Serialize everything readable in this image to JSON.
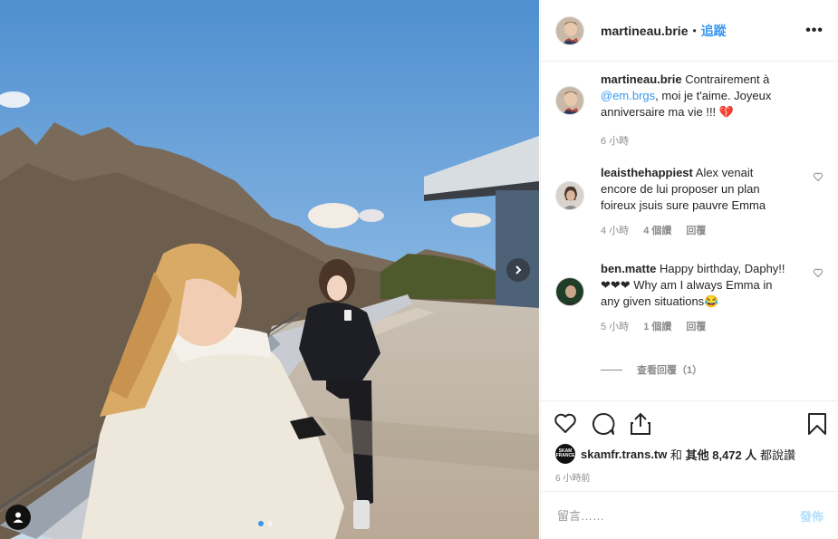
{
  "post": {
    "username": "martineau.brie",
    "separator": "•",
    "follow_label": "追蹤",
    "more_icon": "more-options-icon"
  },
  "photo": {
    "carousel_count": 2,
    "active_index": 0
  },
  "caption": {
    "username": "martineau.brie",
    "text_before": " Contrairement à ",
    "mention": "@em.brgs",
    "text_after": ", moi je t'aime. Joyeux anniversaire ma vie !!! 💔",
    "time": "6 小時"
  },
  "comments": [
    {
      "username": "leaisthehappiest",
      "text": " Alex venait encore de lui proposer un plan foireux jsuis sure pauvre Emma",
      "time": "4 小時",
      "likes": "4 個讚",
      "reply": "回覆"
    },
    {
      "username": "ben.matte",
      "text": " Happy birthday, Daphy!!❤❤❤ Why am I always Emma in any given situations😂",
      "time": "5 小時",
      "likes": "1 個讚",
      "reply": "回覆"
    }
  ],
  "view_replies": "查看回覆（1）",
  "likes": {
    "first_user": "skamfr.trans.tw",
    "text_mid": " 和 ",
    "others": "其他 8,472 人",
    "text_end": " 都說讚",
    "mini_avatar_text": "SKAM FRANCE"
  },
  "timestamp": "6 小時前",
  "add_comment": {
    "placeholder": "留言……",
    "post_label": "發佈"
  },
  "colors": {
    "link": "#3897f0",
    "post_disabled": "#b2dffc",
    "muted": "#8e8e8e"
  }
}
